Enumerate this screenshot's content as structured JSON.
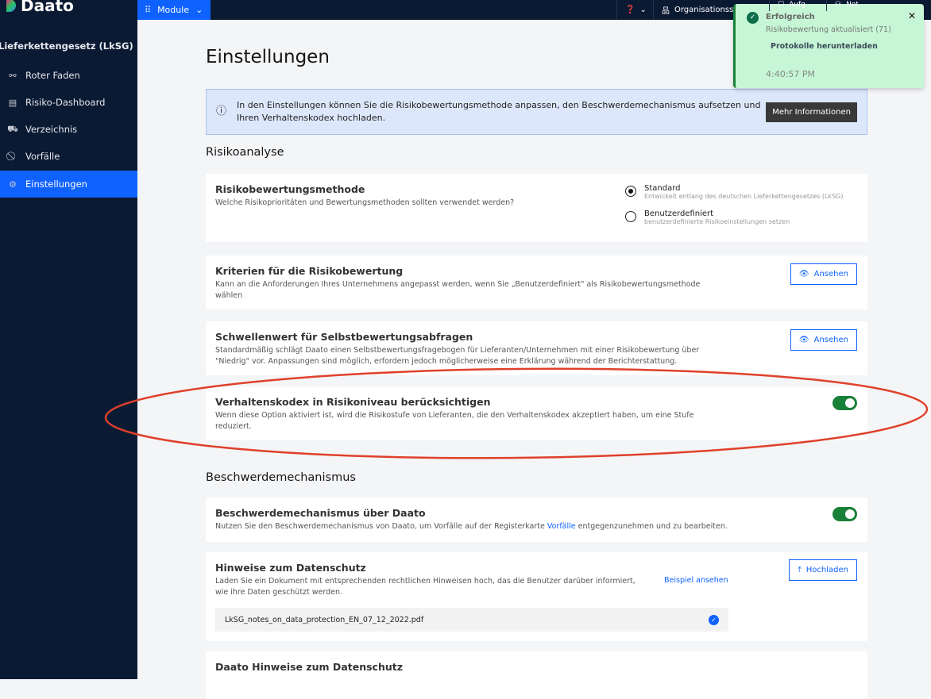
{
  "topbar": {
    "logo": "Daato",
    "module_label": "Module",
    "help_icon": "question-circle-icon",
    "org_label": "Organisationsst",
    "tasks_label": "Aufg",
    "notes_label": "Not"
  },
  "sidebar": {
    "section": "Lieferkettengesetz (LkSG)",
    "items": [
      {
        "label": "Roter Faden",
        "icon": "flow-icon"
      },
      {
        "label": "Risiko-Dashboard",
        "icon": "dashboard-icon"
      },
      {
        "label": "Verzeichnis",
        "icon": "truck-icon"
      },
      {
        "label": "Vorfälle",
        "icon": "prohibited-icon"
      },
      {
        "label": "Einstellungen",
        "icon": "gear-icon",
        "active": true
      }
    ]
  },
  "page": {
    "title": "Einstellungen",
    "info_text": "In den Einstellungen können Sie die Risikobewertungsmethode anpassen, den Beschwerdemechanismus aufsetzen und Ihren Verhaltenskodex hochladen.",
    "info_button": "Mehr Informationen",
    "section1": "Risikoanalyse",
    "method": {
      "title": "Risikobewertungsmethode",
      "desc": "Welche Risikoprioritäten und Bewertungsmethoden sollten verwendet werden?",
      "options": [
        {
          "label": "Standard",
          "sub": "Entwickelt entlang des deutschen Lieferkettengesetzes (LkSG)",
          "selected": true
        },
        {
          "label": "Benutzerdefiniert",
          "sub": "benutzerdefinierte Risikoeinstellungen setzen",
          "selected": false
        }
      ]
    },
    "criteria": {
      "title": "Kriterien für die Risikobewertung",
      "desc": "Kann an die Anforderungen Ihres Unternehmens angepasst werden, wenn Sie „Benutzerdefiniert\" als Risikobewertungsmethode wählen",
      "button": "Ansehen"
    },
    "threshold": {
      "title": "Schwellenwert für Selbstbewertungsabfragen",
      "desc": "Standardmäßig schlägt Daato einen Selbstbewertungsfragebogen für Lieferanten/Unternehmen mit einer Risikobewertung über \"Niedrig\" vor. Anpassungen sind möglich, erfordern jedoch möglicherweise eine Erklärung während der Berichterstattung.",
      "button": "Ansehen"
    },
    "code": {
      "title": "Verhaltenskodex in Risikoniveau berücksichtigen",
      "desc": "Wenn diese Option aktiviert ist, wird die Risikostufe von Lieferanten, die den Verhaltenskodex akzeptiert haben, um eine Stufe reduziert.",
      "enabled": true
    },
    "section2": "Beschwerdemechanismus",
    "complaint": {
      "title": "Beschwerdemechanismus über Daato",
      "desc_pre": "Nutzen Sie den Beschwerdemechanismus von Daato, um Vorfälle auf der Registerkarte ",
      "link": "Vorfälle",
      "desc_post": " entgegenzunehmen und zu bearbeiten.",
      "enabled": true
    },
    "privacy": {
      "title": "Hinweise zum Datenschutz",
      "desc": "Laden Sie ein Dokument mit entsprechenden rechtlichen Hinweisen hoch, das die Benutzer darüber informiert, wie ihre Daten geschützt werden.",
      "link": "Beispiel ansehen",
      "button": "Hochladen",
      "file": "LkSG_notes_on_data_protection_EN_07_12_2022.pdf"
    },
    "daato_privacy": {
      "title": "Daato Hinweise zum Datenschutz"
    }
  },
  "toast": {
    "title": "Erfolgreich",
    "message": "Risikobewertung aktualisiert (71)",
    "action": "Protokolle herunterladen",
    "time": "4:40:57 PM"
  },
  "colors": {
    "primary": "#0f62fe",
    "sidebar": "#0b1a33",
    "toggle_on": "#198038",
    "toast_bg": "#c6f6d5",
    "annotation": "#e0402a"
  }
}
